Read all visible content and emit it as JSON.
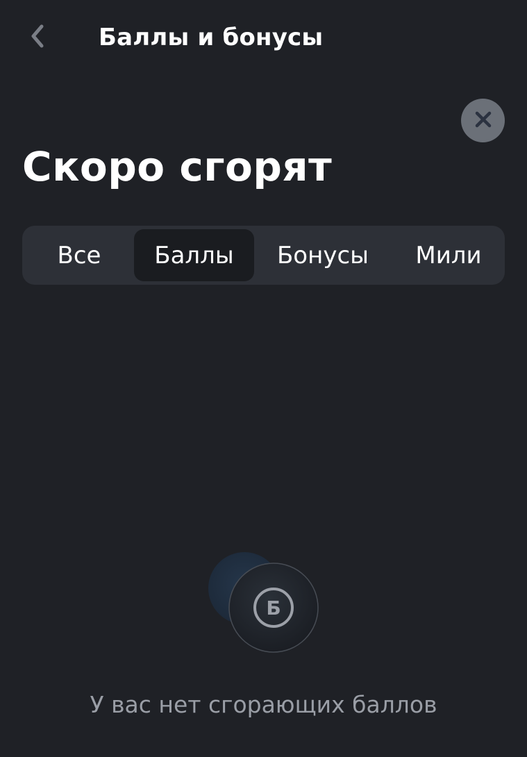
{
  "header": {
    "title": "Баллы и бонусы"
  },
  "sheet": {
    "heading": "Скоро сгорят",
    "tabs": [
      {
        "label": "Все",
        "selected": false
      },
      {
        "label": "Баллы",
        "selected": true
      },
      {
        "label": "Бонусы",
        "selected": false
      },
      {
        "label": "Мили",
        "selected": false
      }
    ],
    "empty_state": {
      "icon_letter": "Б",
      "message": "У вас нет сгорающих баллов"
    }
  },
  "icons": {
    "back": "chevron-left-icon",
    "close": "close-icon",
    "empty": "points-coin-icon"
  },
  "colors": {
    "background": "#1f2126",
    "segment_bg": "#2d3037",
    "segment_selected": "#1a1c20",
    "close_bg": "#6b7078",
    "close_glyph": "#2b3240",
    "muted_text": "#9a9ea6"
  }
}
